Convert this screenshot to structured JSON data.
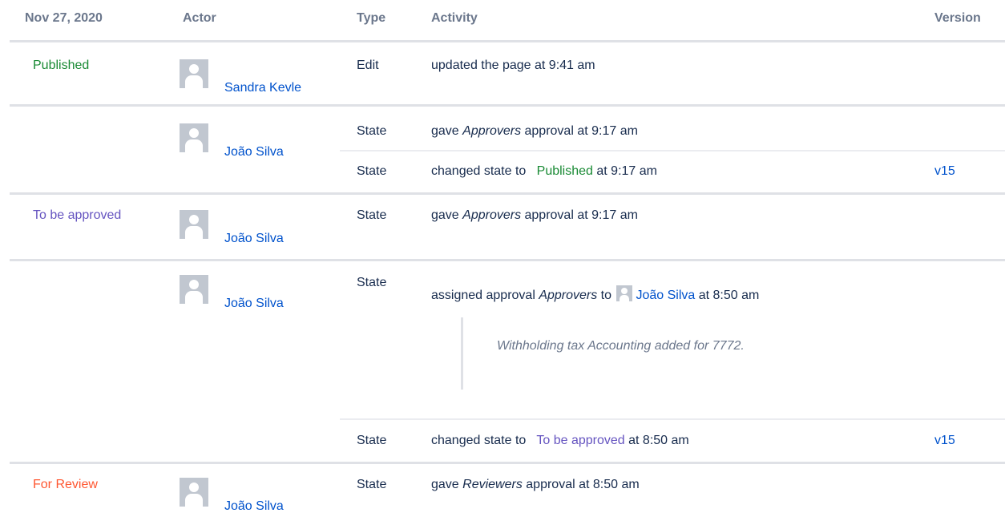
{
  "header": {
    "date": "Nov 27, 2020",
    "actor": "Actor",
    "type": "Type",
    "activity": "Activity",
    "version": "Version"
  },
  "colors": {
    "published": "#198a34",
    "to_be_approved": "#6554c0",
    "for_review": "#ff5630",
    "link": "#0052cc"
  },
  "groups": [
    {
      "state": "Published",
      "actor": "Sandra Kevle",
      "rows": [
        {
          "type": "Edit",
          "activity": "updated the page at 9:41 am"
        }
      ]
    },
    {
      "state": "",
      "actor": "João Silva",
      "rows": [
        {
          "type": "State",
          "pre": "gave ",
          "em": "Approvers",
          "post": " approval at 9:17 am"
        },
        {
          "type": "State",
          "pre": "changed state to ",
          "state": "Published",
          "post": " at 9:17 am",
          "version": "v15"
        }
      ]
    },
    {
      "state": "To be approved",
      "actor": "João Silva",
      "rows": [
        {
          "type": "State",
          "pre": "gave ",
          "em": "Approvers",
          "post": " approval at 9:17 am"
        }
      ]
    },
    {
      "state": "",
      "actor": "João Silva",
      "rows": [
        {
          "type": "State",
          "pre": "assigned approval ",
          "em": "Approvers",
          "mid": " to ",
          "assignee": "João Silva",
          "post": " at 8:50 am",
          "comment": "Withholding tax Accounting added for 7772."
        },
        {
          "type": "State",
          "pre": "changed state to ",
          "state": "To be approved",
          "post": " at 8:50 am",
          "version": "v15"
        }
      ]
    },
    {
      "state": "For Review",
      "actor": "João Silva",
      "rows": [
        {
          "type": "State",
          "pre": "gave ",
          "em": "Reviewers",
          "post": " approval at 8:50 am"
        }
      ]
    }
  ]
}
